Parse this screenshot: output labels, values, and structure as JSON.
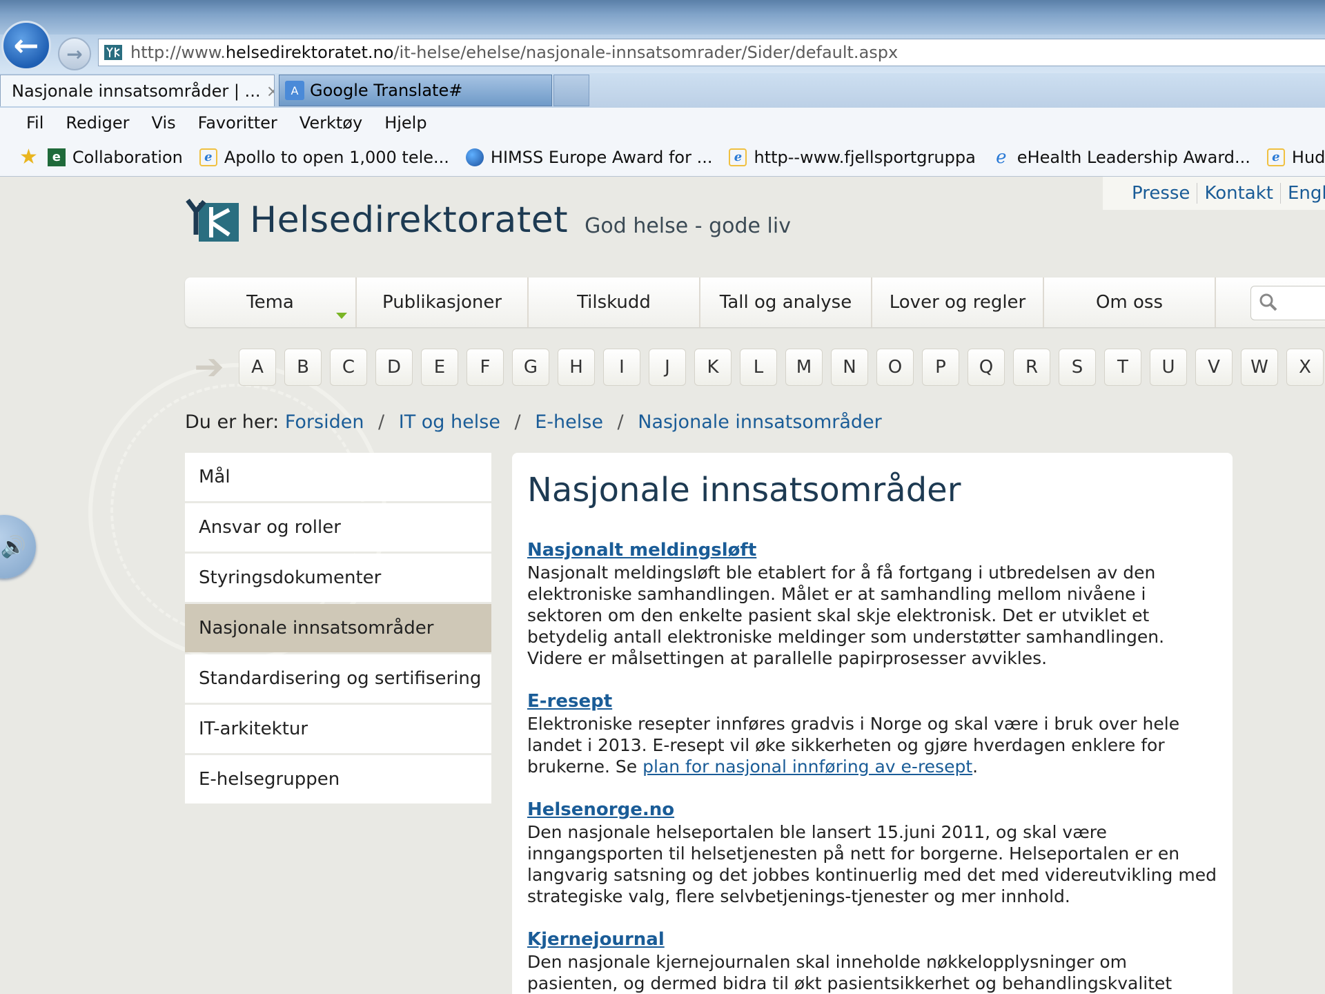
{
  "browser": {
    "url_prefix": "http://www.",
    "url_domain": "helsedirektoratet.no",
    "url_path": "/it-helse/ehelse/nasjonale-innsatsomrader/Sider/default.aspx",
    "tabs": [
      {
        "label": "Nasjonale innsatsområder | ...",
        "active": true
      },
      {
        "label": "Google Translate#",
        "active": false
      }
    ],
    "tab_close": "×",
    "menu": [
      "Fil",
      "Rediger",
      "Vis",
      "Favoritter",
      "Verktøy",
      "Hjelp"
    ],
    "favorites": [
      {
        "label": "Collaboration",
        "icon": "e-hap-icon"
      },
      {
        "label": "Apollo to open 1,000 tele...",
        "icon": "ie-page-icon"
      },
      {
        "label": "HIMSS Europe Award for ...",
        "icon": "globe-icon"
      },
      {
        "label": "http--www.fjellsportgruppa",
        "icon": "ie-page-icon"
      },
      {
        "label": "eHealth Leadership Award...",
        "icon": "ie-logo-icon"
      },
      {
        "label": "Hudlegekontoret -",
        "icon": "ie-page-icon"
      }
    ]
  },
  "site": {
    "toplinks": [
      "Presse",
      "Kontakt",
      "Englis"
    ],
    "logo_text": "Helsedirektoratet",
    "slogan": "God helse - gode liv",
    "nav": [
      "Tema",
      "Publikasjoner",
      "Tilskudd",
      "Tall og analyse",
      "Lover og regler",
      "Om oss"
    ],
    "alphabet": [
      "A",
      "B",
      "C",
      "D",
      "E",
      "F",
      "G",
      "H",
      "I",
      "J",
      "K",
      "L",
      "M",
      "N",
      "O",
      "P",
      "Q",
      "R",
      "S",
      "T",
      "U",
      "V",
      "W",
      "X"
    ],
    "breadcrumb_label": "Du er her:",
    "breadcrumb": [
      "Forsiden",
      "IT og helse",
      "E-helse",
      "Nasjonale innsatsområder"
    ],
    "sep": "/"
  },
  "sidebar": [
    {
      "label": "Mål",
      "active": false
    },
    {
      "label": "Ansvar og roller",
      "active": false
    },
    {
      "label": "Styringsdokumenter",
      "active": false
    },
    {
      "label": "Nasjonale innsatsområder",
      "active": true
    },
    {
      "label": "Standardisering og sertifisering",
      "active": false
    },
    {
      "label": "IT-arkitektur",
      "active": false
    },
    {
      "label": "E-helsegruppen",
      "active": false
    }
  ],
  "content": {
    "heading": "Nasjonale innsatsområder",
    "sections": [
      {
        "title": "Nasjonalt meldingsløft",
        "text": "Nasjonalt meldingsløft ble etablert for å få fortgang i utbredelsen av den elektroniske samhandlingen. Målet er at samhandling mellom nivåene i sektoren om den enkelte pasient skal skje elektronisk. Det er utviklet et betydelig antall elektroniske meldinger som understøtter samhandlingen. Videre er målsettingen at parallelle papirprosesser avvikles."
      },
      {
        "title": "E-resept",
        "text": "Elektroniske resepter innføres gradvis i Norge og skal være i bruk over hele landet i 2013. E-resept vil øke sikkerheten og gjøre hverdagen enklere for brukerne. Se ",
        "link": "plan for nasjonal innføring av e-resept",
        "after": "."
      },
      {
        "title": "Helsenorge.no",
        "text": "Den nasjonale helseportalen ble lansert 15.juni 2011, og skal være inngangsporten til helsetjenesten på nett for borgerne. Helseportalen er en langvarig satsning og det jobbes kontinuerlig med det med videreutvikling med strategiske valg, flere selvbetjenings-tjenester og mer innhold."
      },
      {
        "title": "Kjernejournal",
        "text": "Den nasjonale kjernejournalen skal inneholde nøkkelopplysninger om pasienten, og dermed bidra til økt pasientsikkerhet og behandlingskvalitet"
      }
    ]
  }
}
